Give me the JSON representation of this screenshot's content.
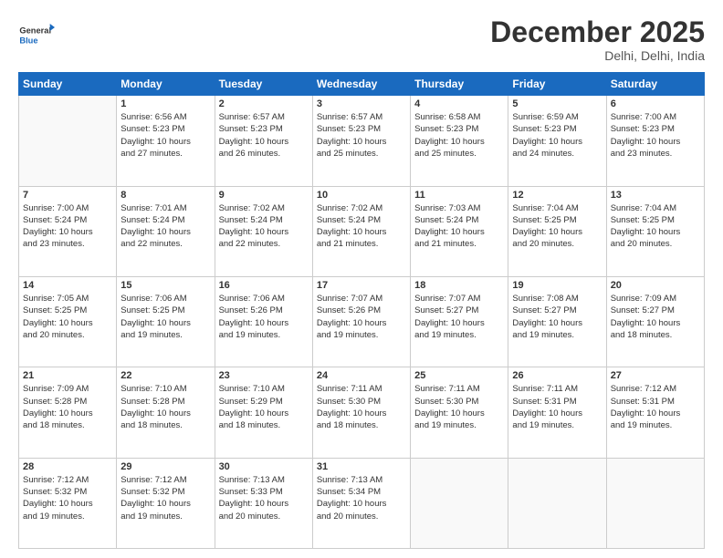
{
  "logo": {
    "line1": "General",
    "line2": "Blue"
  },
  "title": "December 2025",
  "location": "Delhi, Delhi, India",
  "weekdays": [
    "Sunday",
    "Monday",
    "Tuesday",
    "Wednesday",
    "Thursday",
    "Friday",
    "Saturday"
  ],
  "weeks": [
    [
      {
        "day": "",
        "info": ""
      },
      {
        "day": "1",
        "info": "Sunrise: 6:56 AM\nSunset: 5:23 PM\nDaylight: 10 hours\nand 27 minutes."
      },
      {
        "day": "2",
        "info": "Sunrise: 6:57 AM\nSunset: 5:23 PM\nDaylight: 10 hours\nand 26 minutes."
      },
      {
        "day": "3",
        "info": "Sunrise: 6:57 AM\nSunset: 5:23 PM\nDaylight: 10 hours\nand 25 minutes."
      },
      {
        "day": "4",
        "info": "Sunrise: 6:58 AM\nSunset: 5:23 PM\nDaylight: 10 hours\nand 25 minutes."
      },
      {
        "day": "5",
        "info": "Sunrise: 6:59 AM\nSunset: 5:23 PM\nDaylight: 10 hours\nand 24 minutes."
      },
      {
        "day": "6",
        "info": "Sunrise: 7:00 AM\nSunset: 5:23 PM\nDaylight: 10 hours\nand 23 minutes."
      }
    ],
    [
      {
        "day": "7",
        "info": "Sunrise: 7:00 AM\nSunset: 5:24 PM\nDaylight: 10 hours\nand 23 minutes."
      },
      {
        "day": "8",
        "info": "Sunrise: 7:01 AM\nSunset: 5:24 PM\nDaylight: 10 hours\nand 22 minutes."
      },
      {
        "day": "9",
        "info": "Sunrise: 7:02 AM\nSunset: 5:24 PM\nDaylight: 10 hours\nand 22 minutes."
      },
      {
        "day": "10",
        "info": "Sunrise: 7:02 AM\nSunset: 5:24 PM\nDaylight: 10 hours\nand 21 minutes."
      },
      {
        "day": "11",
        "info": "Sunrise: 7:03 AM\nSunset: 5:24 PM\nDaylight: 10 hours\nand 21 minutes."
      },
      {
        "day": "12",
        "info": "Sunrise: 7:04 AM\nSunset: 5:25 PM\nDaylight: 10 hours\nand 20 minutes."
      },
      {
        "day": "13",
        "info": "Sunrise: 7:04 AM\nSunset: 5:25 PM\nDaylight: 10 hours\nand 20 minutes."
      }
    ],
    [
      {
        "day": "14",
        "info": "Sunrise: 7:05 AM\nSunset: 5:25 PM\nDaylight: 10 hours\nand 20 minutes."
      },
      {
        "day": "15",
        "info": "Sunrise: 7:06 AM\nSunset: 5:25 PM\nDaylight: 10 hours\nand 19 minutes."
      },
      {
        "day": "16",
        "info": "Sunrise: 7:06 AM\nSunset: 5:26 PM\nDaylight: 10 hours\nand 19 minutes."
      },
      {
        "day": "17",
        "info": "Sunrise: 7:07 AM\nSunset: 5:26 PM\nDaylight: 10 hours\nand 19 minutes."
      },
      {
        "day": "18",
        "info": "Sunrise: 7:07 AM\nSunset: 5:27 PM\nDaylight: 10 hours\nand 19 minutes."
      },
      {
        "day": "19",
        "info": "Sunrise: 7:08 AM\nSunset: 5:27 PM\nDaylight: 10 hours\nand 19 minutes."
      },
      {
        "day": "20",
        "info": "Sunrise: 7:09 AM\nSunset: 5:27 PM\nDaylight: 10 hours\nand 18 minutes."
      }
    ],
    [
      {
        "day": "21",
        "info": "Sunrise: 7:09 AM\nSunset: 5:28 PM\nDaylight: 10 hours\nand 18 minutes."
      },
      {
        "day": "22",
        "info": "Sunrise: 7:10 AM\nSunset: 5:28 PM\nDaylight: 10 hours\nand 18 minutes."
      },
      {
        "day": "23",
        "info": "Sunrise: 7:10 AM\nSunset: 5:29 PM\nDaylight: 10 hours\nand 18 minutes."
      },
      {
        "day": "24",
        "info": "Sunrise: 7:11 AM\nSunset: 5:30 PM\nDaylight: 10 hours\nand 18 minutes."
      },
      {
        "day": "25",
        "info": "Sunrise: 7:11 AM\nSunset: 5:30 PM\nDaylight: 10 hours\nand 19 minutes."
      },
      {
        "day": "26",
        "info": "Sunrise: 7:11 AM\nSunset: 5:31 PM\nDaylight: 10 hours\nand 19 minutes."
      },
      {
        "day": "27",
        "info": "Sunrise: 7:12 AM\nSunset: 5:31 PM\nDaylight: 10 hours\nand 19 minutes."
      }
    ],
    [
      {
        "day": "28",
        "info": "Sunrise: 7:12 AM\nSunset: 5:32 PM\nDaylight: 10 hours\nand 19 minutes."
      },
      {
        "day": "29",
        "info": "Sunrise: 7:12 AM\nSunset: 5:32 PM\nDaylight: 10 hours\nand 19 minutes."
      },
      {
        "day": "30",
        "info": "Sunrise: 7:13 AM\nSunset: 5:33 PM\nDaylight: 10 hours\nand 20 minutes."
      },
      {
        "day": "31",
        "info": "Sunrise: 7:13 AM\nSunset: 5:34 PM\nDaylight: 10 hours\nand 20 minutes."
      },
      {
        "day": "",
        "info": ""
      },
      {
        "day": "",
        "info": ""
      },
      {
        "day": "",
        "info": ""
      }
    ]
  ]
}
